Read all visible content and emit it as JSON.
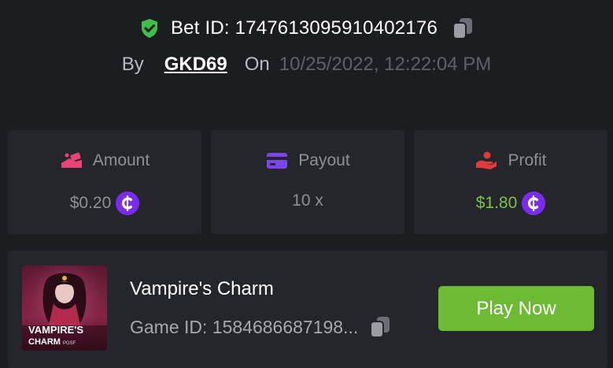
{
  "bet": {
    "id_label": "Bet ID: 1747613095910402176",
    "by_label": "By",
    "username": "GKD69",
    "on_label": "On",
    "datetime": "10/25/2022, 12:22:04 PM"
  },
  "stats": {
    "amount": {
      "label": "Amount",
      "value": "$0.20"
    },
    "payout": {
      "label": "Payout",
      "value": "10 x"
    },
    "profit": {
      "label": "Profit",
      "value": "$1.80"
    }
  },
  "game": {
    "title": "Vampire's Charm",
    "id_text": "Game ID: 1584686687198...",
    "thumb_title": "VAMPIRE'S",
    "thumb_subtitle": "CHARM",
    "thumb_brand": "PGSF",
    "play_label": "Play Now"
  },
  "colors": {
    "background": "#1c1d21",
    "card": "#24262b",
    "accent_green": "#6dbb34",
    "profit_green": "#7ec14a",
    "shield_green": "#3fbf4a",
    "coin_purple": "#7b2bf0",
    "amount_icon": "#e8447a",
    "payout_icon": "#7a45f0",
    "profit_icon": "#e03a3a"
  },
  "icons": {
    "verified": "shield-check-icon",
    "copy": "copy-icon",
    "amount": "money-hand-icon",
    "payout": "card-icon",
    "profit": "hand-coin-icon",
    "currency": "coin-icon"
  }
}
